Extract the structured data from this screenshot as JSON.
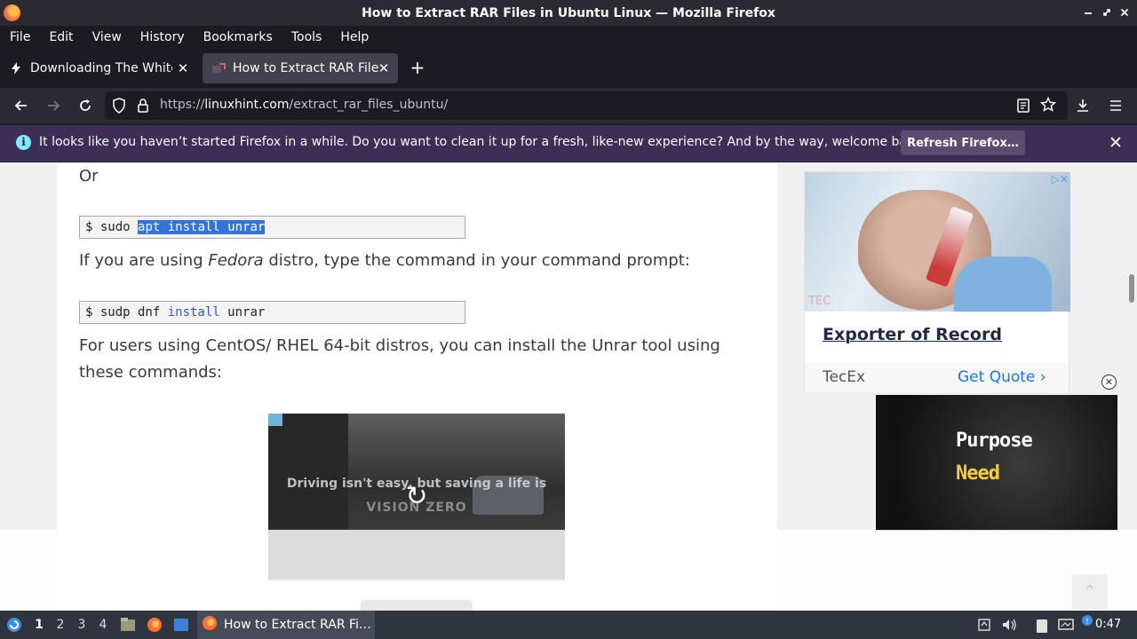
{
  "window": {
    "title": "How to Extract RAR Files in Ubuntu Linux — Mozilla Firefox",
    "controls": [
      "minimize-icon",
      "restore-icon",
      "close-icon"
    ]
  },
  "menubar": {
    "items": [
      "File",
      "Edit",
      "View",
      "History",
      "Bookmarks",
      "Tools",
      "Help"
    ]
  },
  "tabs": [
    {
      "label": "Downloading The White House",
      "active": false,
      "icon": "lightning-icon"
    },
    {
      "label": "How to Extract RAR Files in Ubuntu Linux",
      "active": true,
      "icon": "site-favicon"
    }
  ],
  "navbar": {
    "url_prefix": "https://",
    "url_host": "linuxhint.com",
    "url_path": "/extract_rar_files_ubuntu/"
  },
  "notification": {
    "message": "It looks like you haven’t started Firefox in a while. Do you want to clean it up for a fresh, like-new experience? And by the way, welcome back!",
    "button": "Refresh Firefox…"
  },
  "article": {
    "or_text": "Or",
    "cmd1_prefix": "$ sudo ",
    "cmd1_selected": "apt install unrar",
    "fedora_before": "If you are using ",
    "fedora_em": "Fedora",
    "fedora_after": " distro, type the command in your command prompt:",
    "cmd2_prefix": "$ sudp dnf ",
    "cmd2_kw": "install",
    "cmd2_after": " unrar",
    "centos_line1": "For users using CentOS/ RHEL 64-bit distros, you can install the Unrar tool using",
    "centos_line2": "these commands:",
    "video_caption": "Driving isn't easy, but saving a life is",
    "video_brand": "VISION ZERO"
  },
  "sidebar_ad": {
    "photo_logo": "TEC",
    "headline": "Exporter of Record",
    "brand": "TecEx",
    "cta": "Get Quote"
  },
  "video_ad": {
    "line1": "Purpose",
    "line2": "Need"
  },
  "taskbar": {
    "workspaces": [
      "1",
      "2",
      "3",
      "4"
    ],
    "active_workspace": "1",
    "app_label": "How to Extract RAR Fi…",
    "clock": "0:47"
  }
}
